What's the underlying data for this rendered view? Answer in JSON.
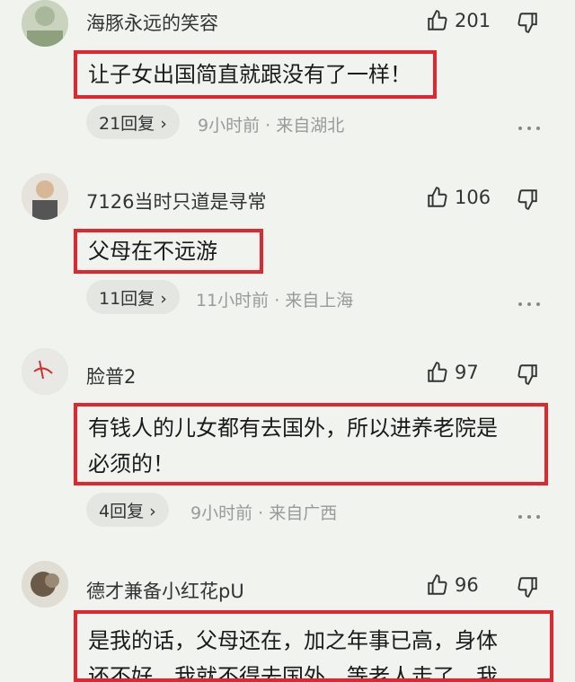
{
  "comments": [
    {
      "username": "海豚永远的笑容",
      "likes": "201",
      "text_lines": [
        "让子女出国简直就跟没有了一样！"
      ],
      "replies": "21回复 ›",
      "meta": "9小时前 · 来自湖北"
    },
    {
      "username": "7126当时只道是寻常",
      "likes": "106",
      "text_lines": [
        "父母在不远游"
      ],
      "replies": "11回复 ›",
      "meta": "11小时前 · 来自上海"
    },
    {
      "username": "脸普2",
      "likes": "97",
      "text_lines": [
        "有钱人的儿女都有去国外，所以进养老院是",
        "必须的！"
      ],
      "replies": "4回复 ›",
      "meta": "9小时前 · 来自广西"
    },
    {
      "username": "德才兼备小红花pU",
      "likes": "96",
      "text_lines": [
        "是我的话，父母还在，加之年事已高，身体",
        "还不好，我就不得去国外，等老人走了，我"
      ]
    }
  ],
  "icons": {
    "like": "thumbs-up-icon",
    "dislike": "thumbs-down-icon",
    "more": "more-dots-icon"
  },
  "colors": {
    "highlight_border": "#e0262f",
    "background": "#f1f3ee"
  }
}
